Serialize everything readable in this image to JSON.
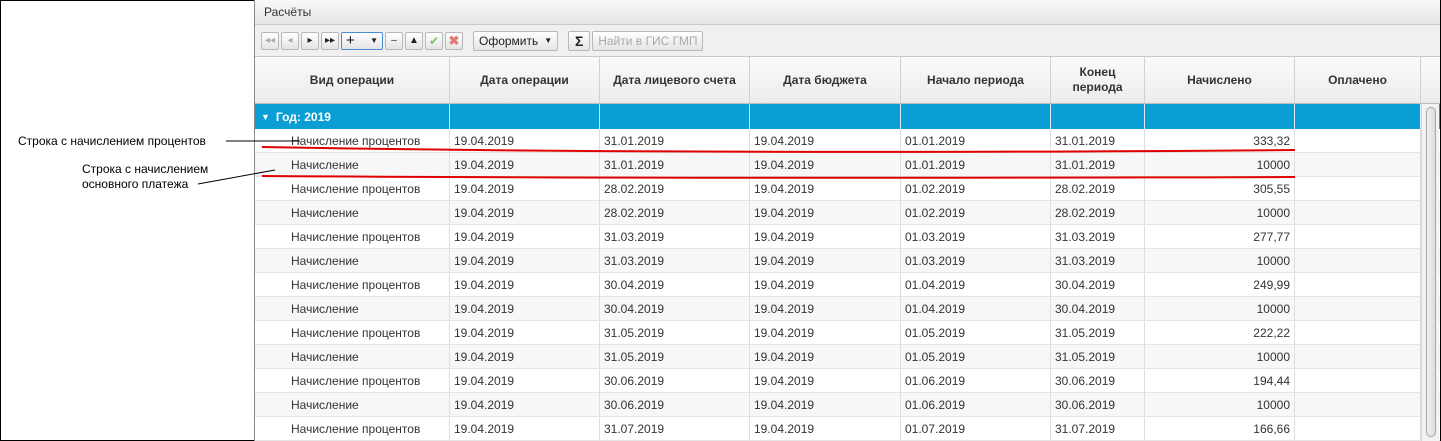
{
  "annotations": {
    "interest_row": "Строка с начислением процентов",
    "principal_row_line1": "Строка  с начислением",
    "principal_row_line2": "основного платежа"
  },
  "panel": {
    "title": "Расчёты"
  },
  "toolbar": {
    "first_icon": "skip-first-icon",
    "prev_icon": "prev-icon",
    "next_icon": "next-icon",
    "last_icon": "skip-last-icon",
    "add_label": "+",
    "remove_label": "–",
    "up_icon": "arrow-up-icon",
    "confirm_icon": "check-icon",
    "cancel_icon": "cross-icon",
    "format_label": "Оформить",
    "sum_label": "Σ",
    "gis_label": "Найти в ГИС ГМП"
  },
  "columns": [
    "Вид операции",
    "Дата операции",
    "Дата лицевого счета",
    "Дата бюджета",
    "Начало периода",
    "Конец\nпериода",
    "Начислено",
    "Оплачено"
  ],
  "group": {
    "label": "Год: 2019"
  },
  "rows": [
    [
      "Начисление процентов",
      "19.04.2019",
      "31.01.2019",
      "19.04.2019",
      "01.01.2019",
      "31.01.2019",
      "333,32",
      ""
    ],
    [
      "Начисление",
      "19.04.2019",
      "31.01.2019",
      "19.04.2019",
      "01.01.2019",
      "31.01.2019",
      "10000",
      ""
    ],
    [
      "Начисление процентов",
      "19.04.2019",
      "28.02.2019",
      "19.04.2019",
      "01.02.2019",
      "28.02.2019",
      "305,55",
      ""
    ],
    [
      "Начисление",
      "19.04.2019",
      "28.02.2019",
      "19.04.2019",
      "01.02.2019",
      "28.02.2019",
      "10000",
      ""
    ],
    [
      "Начисление процентов",
      "19.04.2019",
      "31.03.2019",
      "19.04.2019",
      "01.03.2019",
      "31.03.2019",
      "277,77",
      ""
    ],
    [
      "Начисление",
      "19.04.2019",
      "31.03.2019",
      "19.04.2019",
      "01.03.2019",
      "31.03.2019",
      "10000",
      ""
    ],
    [
      "Начисление процентов",
      "19.04.2019",
      "30.04.2019",
      "19.04.2019",
      "01.04.2019",
      "30.04.2019",
      "249,99",
      ""
    ],
    [
      "Начисление",
      "19.04.2019",
      "30.04.2019",
      "19.04.2019",
      "01.04.2019",
      "30.04.2019",
      "10000",
      ""
    ],
    [
      "Начисление процентов",
      "19.04.2019",
      "31.05.2019",
      "19.04.2019",
      "01.05.2019",
      "31.05.2019",
      "222,22",
      ""
    ],
    [
      "Начисление",
      "19.04.2019",
      "31.05.2019",
      "19.04.2019",
      "01.05.2019",
      "31.05.2019",
      "10000",
      ""
    ],
    [
      "Начисление процентов",
      "19.04.2019",
      "30.06.2019",
      "19.04.2019",
      "01.06.2019",
      "30.06.2019",
      "194,44",
      ""
    ],
    [
      "Начисление",
      "19.04.2019",
      "30.06.2019",
      "19.04.2019",
      "01.06.2019",
      "30.06.2019",
      "10000",
      ""
    ],
    [
      "Начисление процентов",
      "19.04.2019",
      "31.07.2019",
      "19.04.2019",
      "01.07.2019",
      "31.07.2019",
      "166,66",
      ""
    ]
  ],
  "colors": {
    "group_bg": "#0b9ed4",
    "highlight_line": "#e00000",
    "add_button_border": "#4a8ad0"
  }
}
